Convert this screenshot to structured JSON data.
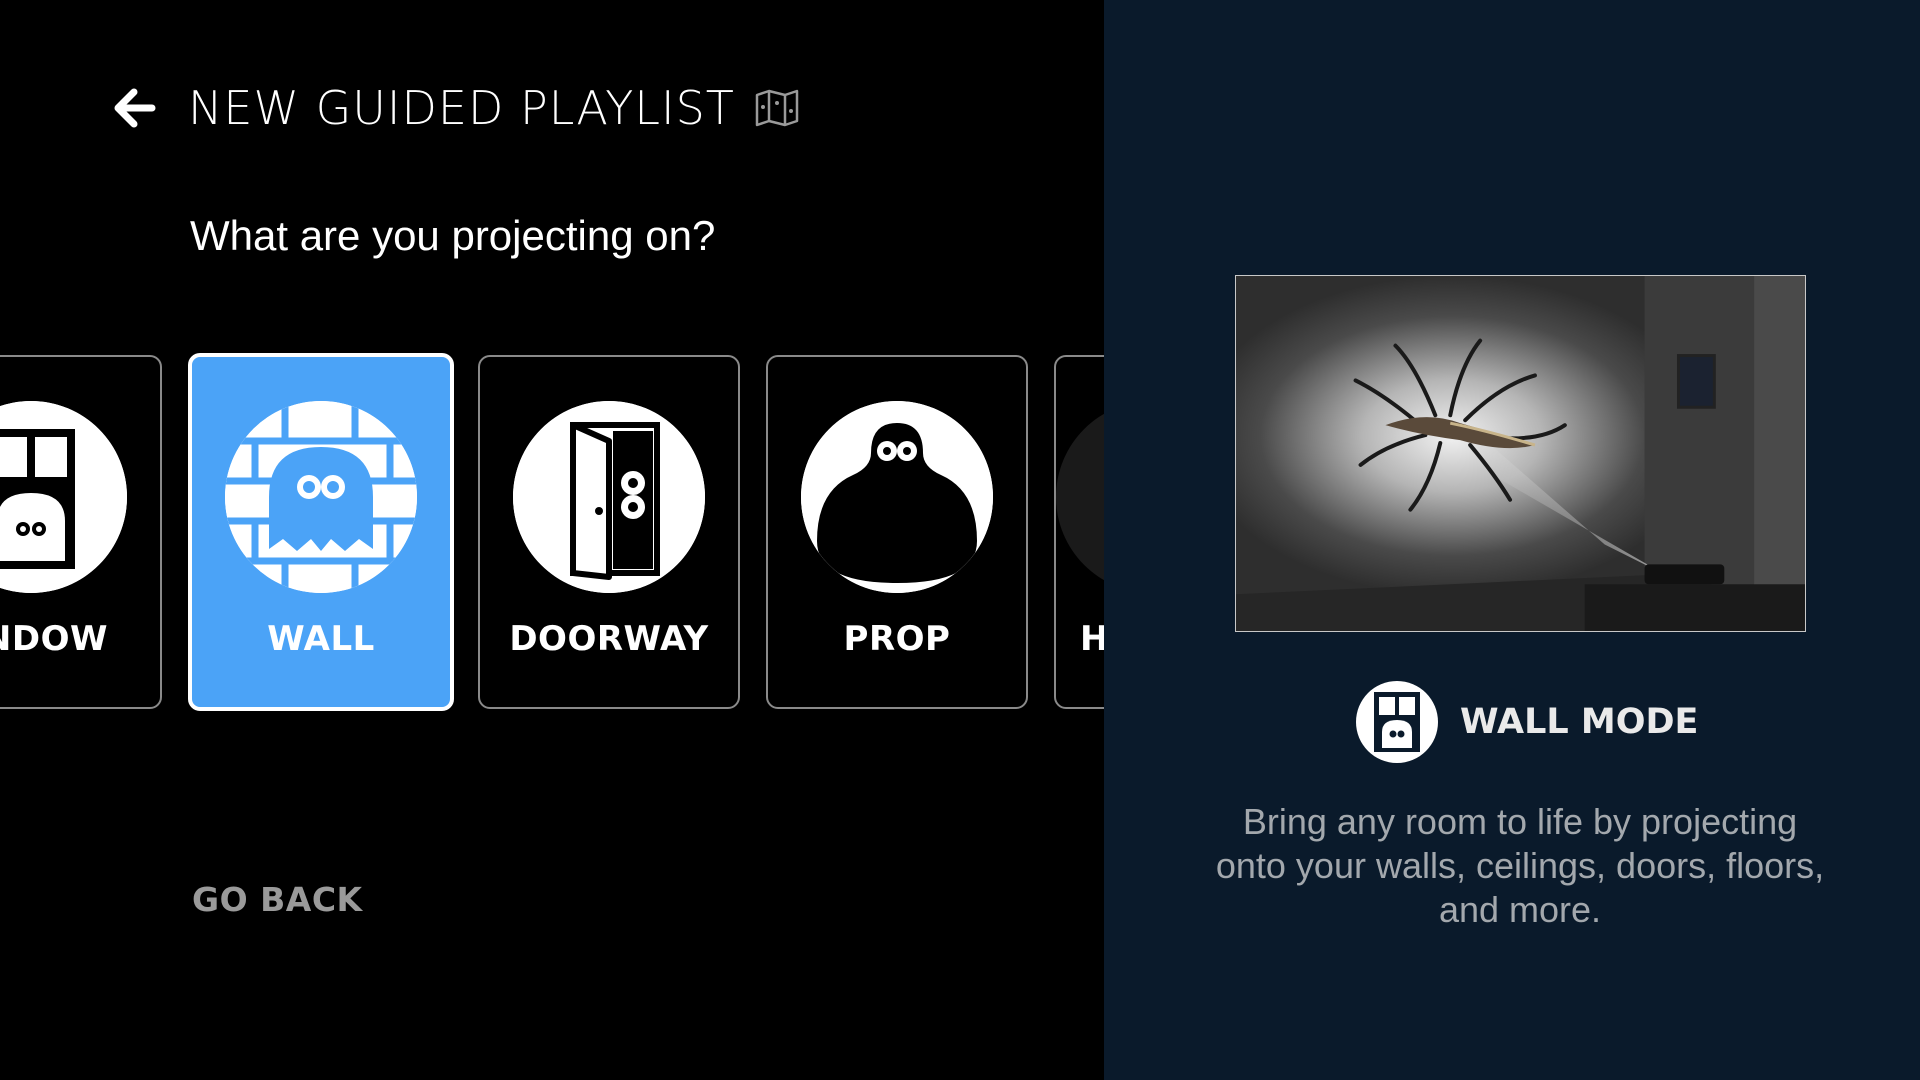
{
  "header": {
    "title": "NEW GUIDED PLAYLIST",
    "back_icon": "arrow-left-icon",
    "map_icon": "map-icon"
  },
  "question": "What are you projecting on?",
  "cards": [
    {
      "id": "window",
      "label": "NDOW",
      "icon": "window-icon",
      "selected": false
    },
    {
      "id": "wall",
      "label": "WALL",
      "icon": "ghost-wall-icon",
      "selected": true
    },
    {
      "id": "doorway",
      "label": "DOORWAY",
      "icon": "doorway-icon",
      "selected": false
    },
    {
      "id": "prop",
      "label": "PROP",
      "icon": "prop-icon",
      "selected": false
    },
    {
      "id": "partial",
      "label": "H",
      "icon": "partial-icon",
      "selected": false
    }
  ],
  "go_back": "GO BACK",
  "detail": {
    "mode_title": "WALL MODE",
    "mode_icon": "window-ghost-icon",
    "description": "Bring any room to life by projecting onto your walls, ceilings, doors, floors, and more."
  },
  "colors": {
    "accent": "#4ba3f7",
    "right_panel": "#0a1a2b",
    "muted_text": "#a3a8ad"
  }
}
